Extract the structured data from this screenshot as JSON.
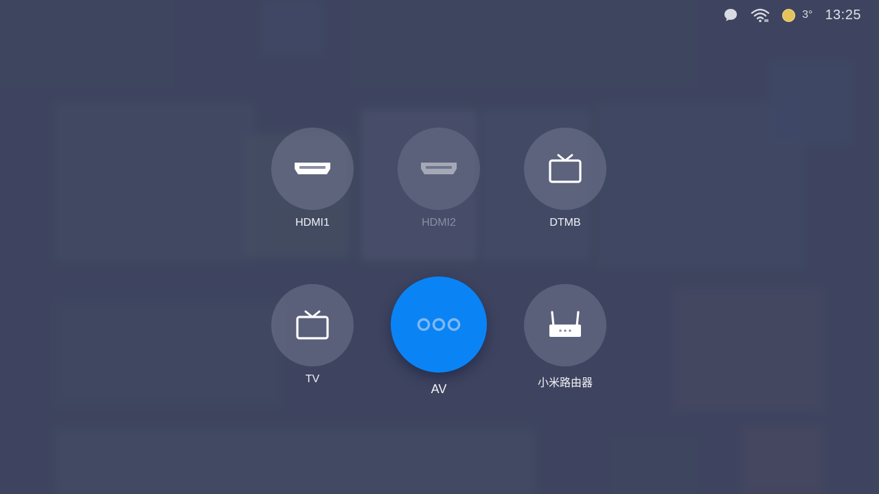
{
  "status_bar": {
    "temperature": "3°",
    "time": "13:25",
    "icons": [
      "message-icon",
      "wifi-icon",
      "weather-sun-icon"
    ]
  },
  "sources": [
    {
      "id": "hdmi1",
      "label": "HDMI1",
      "icon": "hdmi-port-icon",
      "state": "normal"
    },
    {
      "id": "hdmi2",
      "label": "HDMI2",
      "icon": "hdmi-port-icon",
      "state": "disabled"
    },
    {
      "id": "dtmb",
      "label": "DTMB",
      "icon": "tv-icon",
      "state": "normal"
    },
    {
      "id": "tv",
      "label": "TV",
      "icon": "tv-icon",
      "state": "normal"
    },
    {
      "id": "av",
      "label": "AV",
      "icon": "av-dots-icon",
      "state": "focused"
    },
    {
      "id": "router",
      "label": "小米路由器",
      "icon": "router-icon",
      "state": "normal"
    }
  ],
  "colors": {
    "focus": "#0a84f5",
    "background": "#40475f",
    "tile": "#84889f"
  }
}
